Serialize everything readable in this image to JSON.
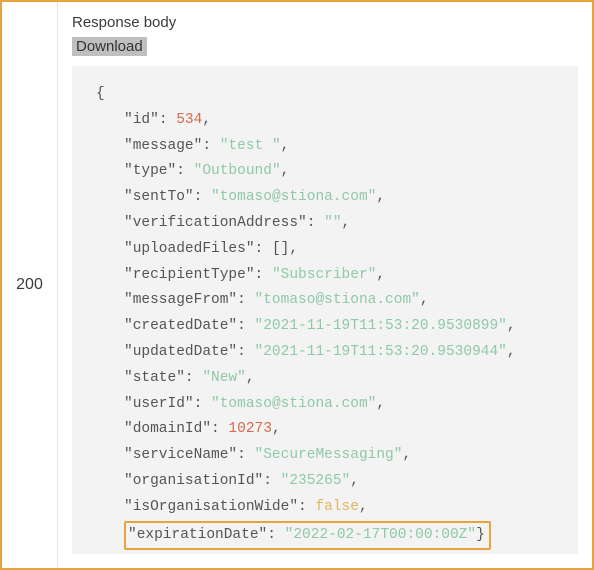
{
  "status_code": "200",
  "response_label": "Response body",
  "download_label": "Download",
  "json": {
    "open": "{",
    "close": "}",
    "comma": ",",
    "colon": ": ",
    "empty_array": "[]",
    "q": "\"",
    "fields": {
      "id": {
        "key": "id",
        "val": "534",
        "type": "num"
      },
      "message": {
        "key": "message",
        "val": "test ",
        "type": "str"
      },
      "type": {
        "key": "type",
        "val": "Outbound",
        "type": "str"
      },
      "sentTo": {
        "key": "sentTo",
        "val": "tomaso@stiona.com",
        "type": "str"
      },
      "verificationAddress": {
        "key": "verificationAddress",
        "val": "",
        "type": "str"
      },
      "uploadedFiles": {
        "key": "uploadedFiles",
        "val": "[]",
        "type": "arr"
      },
      "recipientType": {
        "key": "recipientType",
        "val": "Subscriber",
        "type": "str"
      },
      "messageFrom": {
        "key": "messageFrom",
        "val": "tomaso@stiona.com",
        "type": "str"
      },
      "createdDate": {
        "key": "createdDate",
        "val": "2021-11-19T11:53:20.9530899",
        "type": "str"
      },
      "updatedDate": {
        "key": "updatedDate",
        "val": "2021-11-19T11:53:20.9530944",
        "type": "str"
      },
      "state": {
        "key": "state",
        "val": "New",
        "type": "str"
      },
      "userId": {
        "key": "userId",
        "val": "tomaso@stiona.com",
        "type": "str"
      },
      "domainId": {
        "key": "domainId",
        "val": "10273",
        "type": "num"
      },
      "serviceName": {
        "key": "serviceName",
        "val": "SecureMessaging",
        "type": "str"
      },
      "organisationId": {
        "key": "organisationId",
        "val": "235265",
        "type": "str"
      },
      "isOrganisationWide": {
        "key": "isOrganisationWide",
        "val": "false",
        "type": "bool"
      },
      "expirationDate": {
        "key": "expirationDate",
        "val": "2022-02-17T00:00:00Z",
        "type": "str",
        "highlight": true,
        "last": true
      }
    }
  }
}
